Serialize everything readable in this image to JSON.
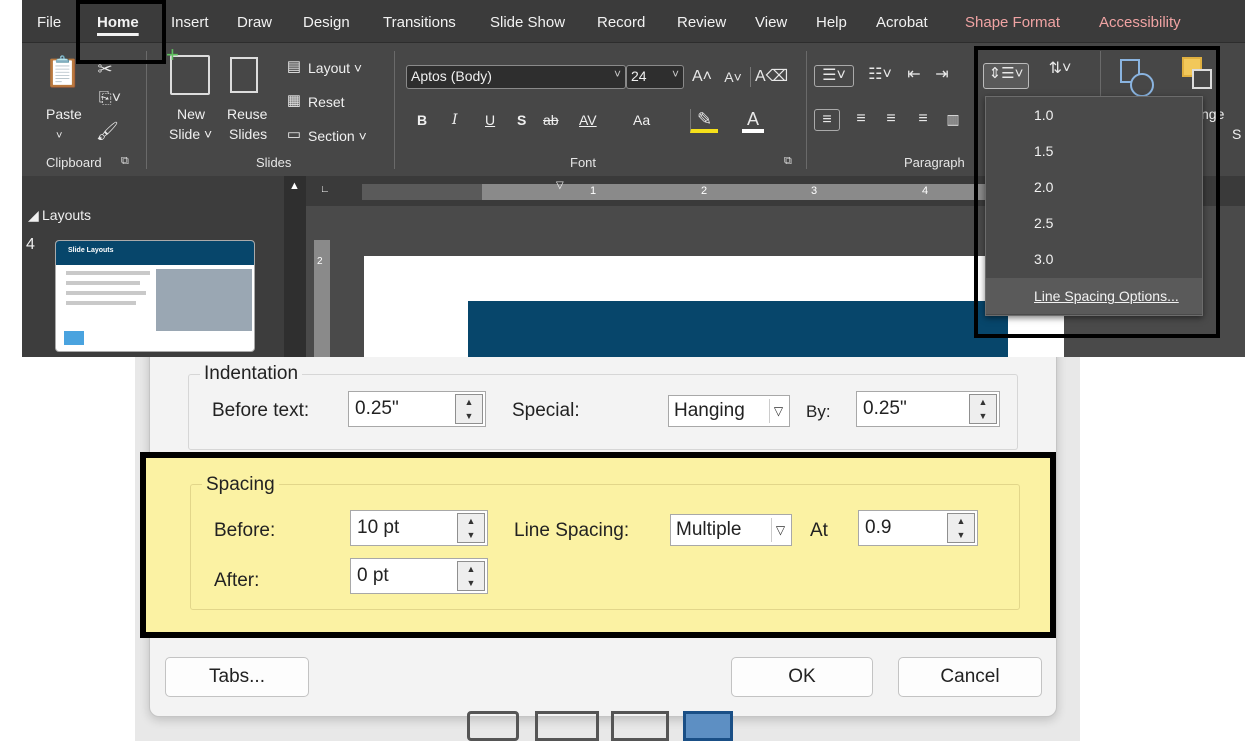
{
  "ribbon": {
    "tabs": [
      "File",
      "Home",
      "Insert",
      "Draw",
      "Design",
      "Transitions",
      "Slide Show",
      "Record",
      "Review",
      "View",
      "Help",
      "Acrobat",
      "Shape Format",
      "Accessibility"
    ],
    "clipboard": {
      "paste": "Paste",
      "group": "Clipboard"
    },
    "slides": {
      "new": "New",
      "new2": "Slide ˅",
      "reuse": "Reuse",
      "reuse2": "Slides",
      "layout": "Layout ˅",
      "reset": "Reset",
      "section": "Section ˅",
      "group": "Slides"
    },
    "font": {
      "name": "Aptos (Body)",
      "size": "24",
      "group": "Font",
      "bold": "B",
      "italic": "I",
      "underline": "U",
      "shadow": "S",
      "strike": "ab",
      "spacing": "AV",
      "case": "Aa"
    },
    "paragraph": {
      "group": "Paragraph"
    },
    "cut_off_right": "nge",
    "cut_off_s": "S"
  },
  "line_spacing_menu": {
    "items": [
      "1.0",
      "1.5",
      "2.0",
      "2.5",
      "3.0"
    ],
    "options": "Line Spacing Options..."
  },
  "pane": {
    "section": "Layouts",
    "slide_number": "4",
    "thumb_title": "Slide Layouts"
  },
  "ruler": {
    "numbers": [
      "1",
      "2",
      "3",
      "4"
    ],
    "v_number": "2"
  },
  "dialog": {
    "indentation": {
      "legend": "Indentation",
      "before_text_label": "Before text:",
      "before_text_value": "0.25\"",
      "special_label": "Special:",
      "special_value": "Hanging",
      "by_label": "By:",
      "by_value": "0.25\""
    },
    "spacing": {
      "legend": "Spacing",
      "before_label": "Before:",
      "before_value": "10 pt",
      "after_label": "After:",
      "after_value": "0 pt",
      "line_spacing_label": "Line Spacing:",
      "line_spacing_value": "Multiple",
      "at_label": "At",
      "at_value": "0.9"
    },
    "buttons": {
      "tabs": "Tabs...",
      "ok": "OK",
      "cancel": "Cancel"
    }
  },
  "colors": {
    "highlight": "#fbf2a3",
    "slide_title_bg": "#07466b",
    "outline": "#000000"
  }
}
